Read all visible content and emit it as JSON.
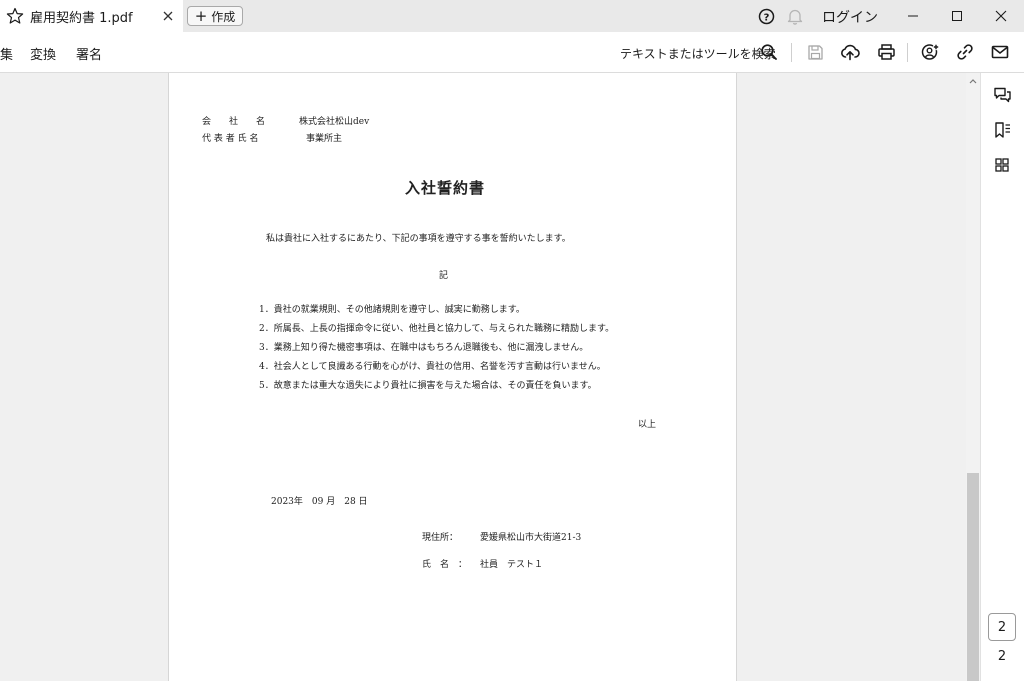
{
  "tab": {
    "title": "雇用契約書 1.pdf"
  },
  "titlebar": {
    "create_label": "作成",
    "login_label": "ログイン"
  },
  "menu": [
    "集",
    "変換",
    "署名"
  ],
  "toolbar": {
    "search_label": "テキストまたはツールを検索"
  },
  "document": {
    "company_label": "会　　社　　名",
    "company_value": "株式会社松山dev",
    "rep_label": "代 表 者 氏 名",
    "rep_value": "事業所主",
    "title": "入社誓約書",
    "intro": "私は貴社に入社するにあたり、下記の事項を遵守する事を誓約いたします。",
    "ki": "記",
    "items": [
      "1．貴社の就業規則、その他諸規則を遵守し、誠実に勤務します。",
      "2．所属長、上長の指揮命令に従い、他社員と協力して、与えられた職務に精励します。",
      "3．業務上知り得た機密事項は、在職中はもちろん退職後も、他に漏洩しません。",
      "4．社会人として良識ある行動を心がけ、貴社の信用、名誉を汚す言動は行いません。",
      "5．故意または重大な過失により貴社に損害を与えた場合は、その責任を負います。"
    ],
    "ijou": "以上",
    "date": "2023年　09 月　28 日",
    "address_label": "現住所：",
    "address_value": "愛媛県松山市大街道21-3",
    "name_label": "氏　名　：",
    "name_value": "社員　テスト１"
  },
  "pagination": {
    "current": "2",
    "total": "2"
  },
  "icons": {
    "tab": "star-icon",
    "help": "help-icon",
    "bell": "bell-icon",
    "search": "search-icon",
    "save": "save-icon",
    "upload": "cloud-upload-icon",
    "print": "print-icon",
    "share": "share-user-icon",
    "link": "link-icon",
    "mail": "mail-icon",
    "comments": "comments-icon",
    "bookmarks": "bookmarks-icon",
    "thumbnails": "thumbnails-icon"
  }
}
